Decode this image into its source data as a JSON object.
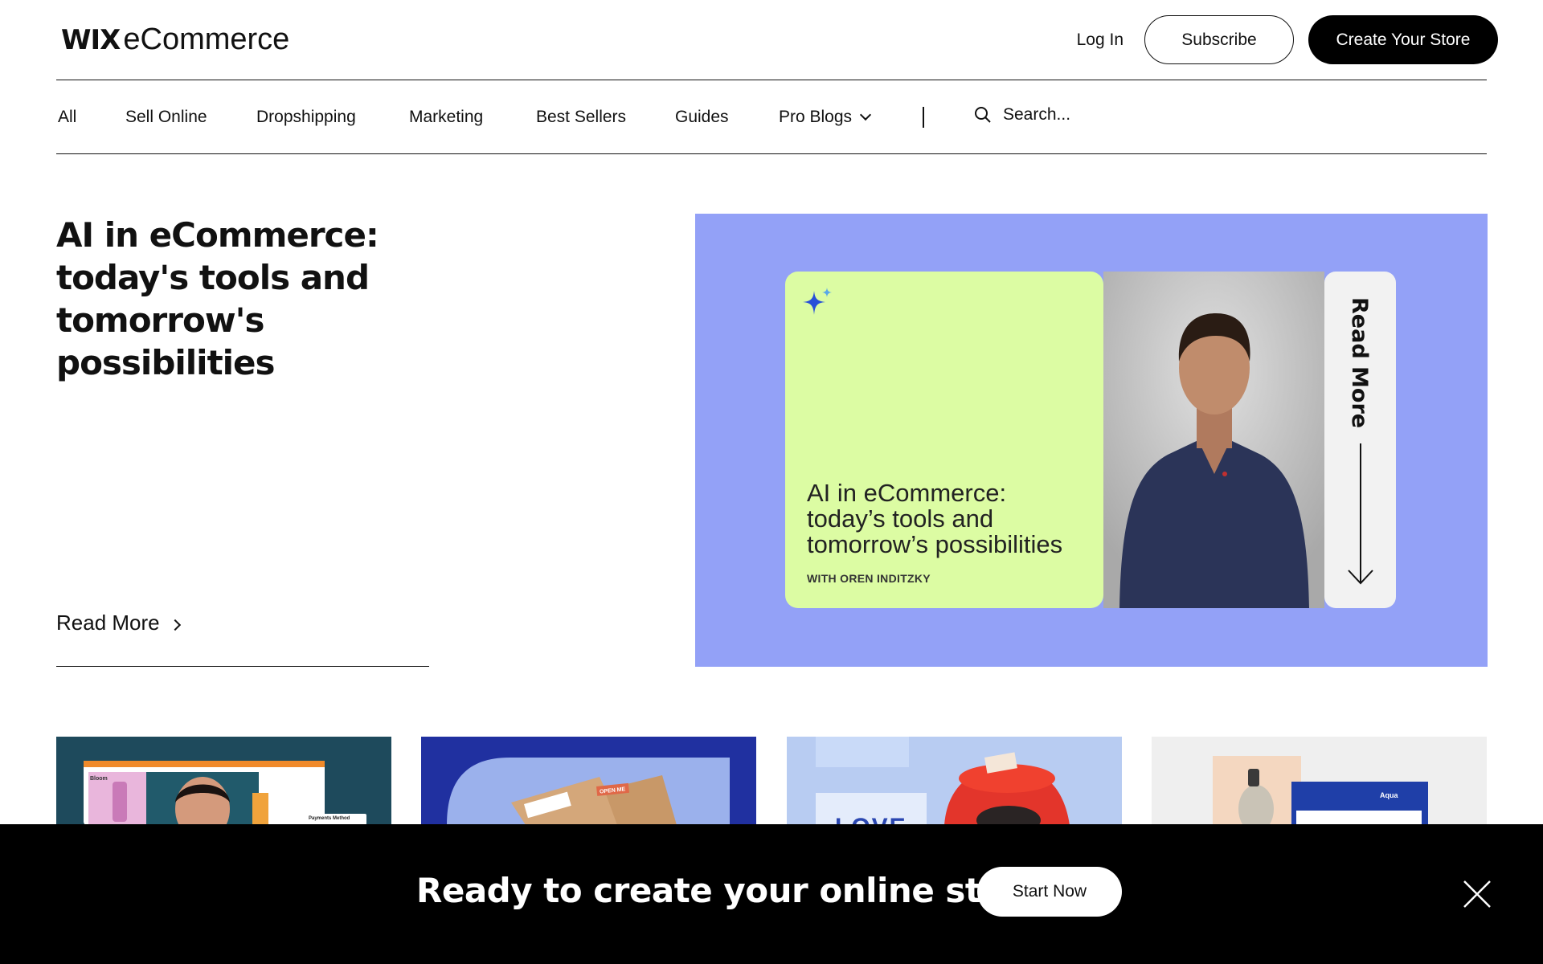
{
  "header": {
    "logo_wix": "WIX",
    "logo_ecommerce": "eCommerce",
    "login": "Log In",
    "subscribe": "Subscribe",
    "create_store": "Create Your Store"
  },
  "nav": {
    "items": [
      "All",
      "Sell Online",
      "Dropshipping",
      "Marketing",
      "Best Sellers",
      "Guides",
      "Pro Blogs"
    ],
    "search_placeholder": "Search..."
  },
  "hero": {
    "title": "AI in eCommerce: today's tools and tomorrow's possibilities",
    "read_more": "Read More",
    "image": {
      "card_title_line1": "AI in eCommerce:",
      "card_title_line2": "today’s tools and",
      "card_title_line3": "tomorrow’s possibilities",
      "card_with": "WITH OREN INDITZKY",
      "side_label": "Read More",
      "background_color": "#93a1f7",
      "card_color": "#dcfca3"
    }
  },
  "thumbnails": {
    "t1_brand": "Bloom",
    "t1_payment": "Payments Method",
    "t2_tag": "OPEN ME",
    "t3_text": "LOVE",
    "t4_brand": "Aqua"
  },
  "banner": {
    "text": "Ready to create your online store?",
    "button": "Start Now"
  }
}
